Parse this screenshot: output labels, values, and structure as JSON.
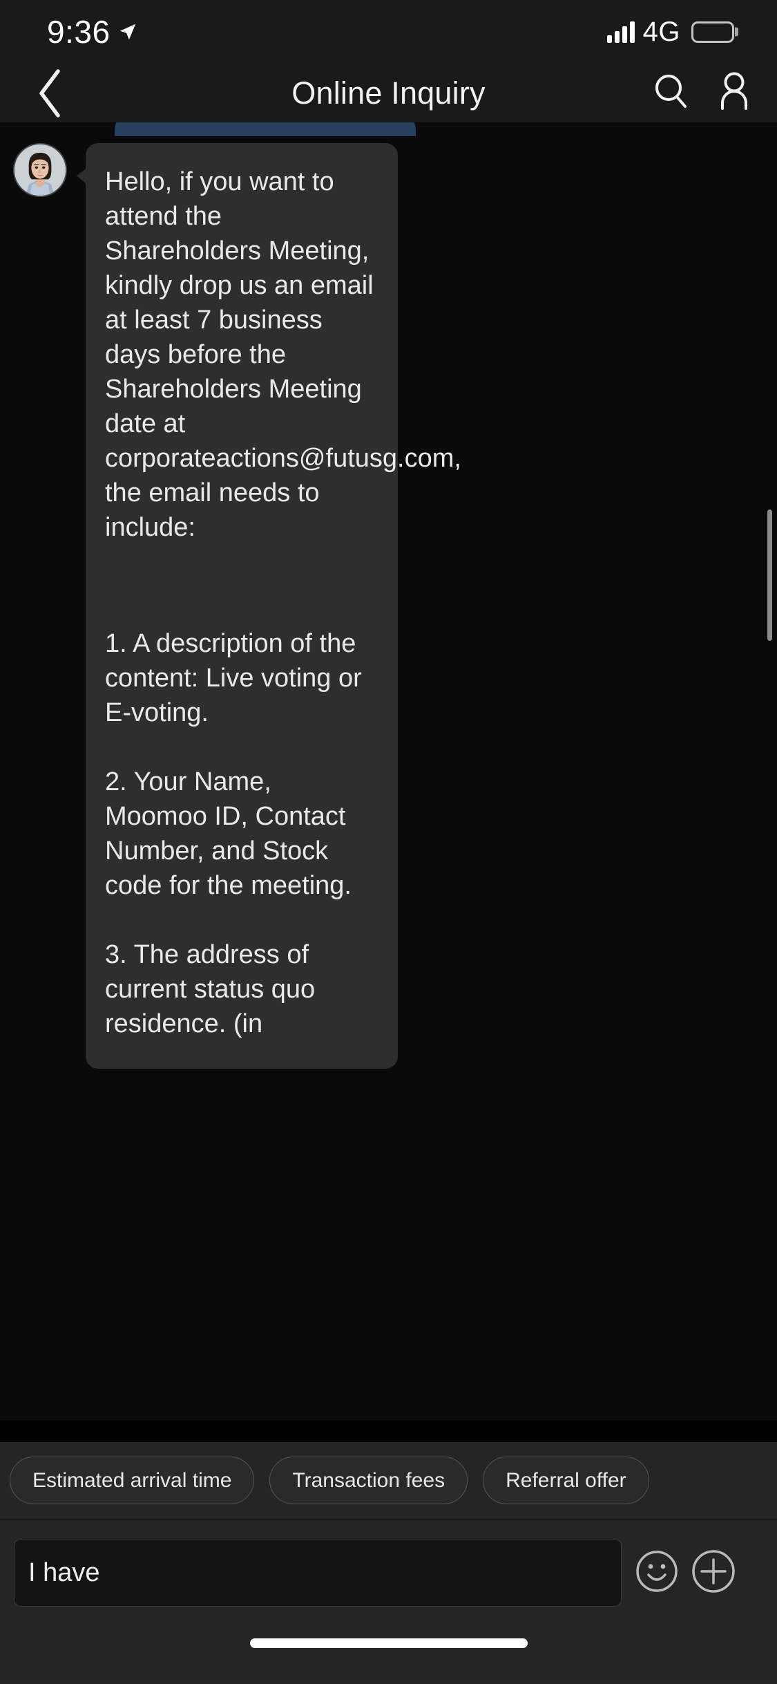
{
  "status_bar": {
    "time": "9:36",
    "location_icon": "location-arrow-icon",
    "signal_icon": "cellular-bars-icon",
    "network": "4G",
    "battery_icon": "battery-full-icon"
  },
  "nav_bar": {
    "back_icon": "chevron-left-icon",
    "title": "Online Inquiry",
    "search_icon": "search-icon",
    "profile_icon": "person-icon"
  },
  "chat": {
    "avatar_name": "agent-avatar",
    "previous_bubble_color": "#26405e",
    "bubble_color": "#2e2e2e",
    "scrollbar_name": "vertical-scrollbar",
    "message": {
      "intro": "Hello, if you want to attend the Shareholders Meeting, kindly drop us an email at least 7 business days before the Shareholders Meeting date at corporateactions@futusg.com, the email needs to include:",
      "item1": "1. A description of the content: Live voting or E-voting.",
      "item2": "2. Your Name, Moomoo ID, Contact Number, and Stock code for the meeting.",
      "item3": "3. The address of current status quo residence. (in"
    }
  },
  "quick_replies": {
    "chips": [
      {
        "label": "Estimated arrival time"
      },
      {
        "label": "Transaction fees"
      },
      {
        "label": "Referral offer"
      }
    ]
  },
  "input_bar": {
    "value": "I have",
    "placeholder": "",
    "emoji_icon": "smiley-face-icon",
    "add_icon": "plus-circle-icon"
  }
}
